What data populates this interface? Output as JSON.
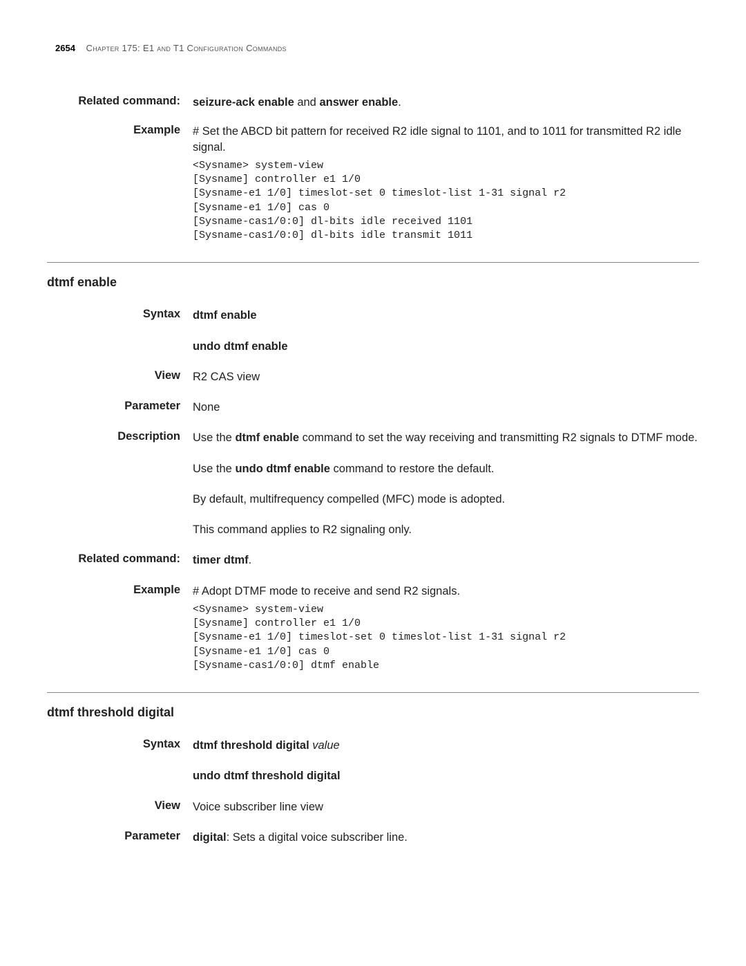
{
  "header": {
    "page_number": "2654",
    "chapter_text": "Chapter 175: E1 and T1 Configuration Commands"
  },
  "section1": {
    "related_command_label": "Related command:",
    "related_command_text_1": "seizure-ack enable",
    "related_command_mid": " and ",
    "related_command_text_2": "answer enable",
    "related_command_end": ".",
    "example_label": "Example",
    "example_intro": "# Set the ABCD bit pattern for received R2 idle signal to 1101, and to 1011 for transmitted R2 idle signal.",
    "code": "<Sysname> system-view\n[Sysname] controller e1 1/0\n[Sysname-e1 1/0] timeslot-set 0 timeslot-list 1-31 signal r2\n[Sysname-e1 1/0] cas 0\n[Sysname-cas1/0:0] dl-bits idle received 1101\n[Sysname-cas1/0:0] dl-bits idle transmit 1011"
  },
  "section2": {
    "title": "dtmf enable",
    "syntax_label": "Syntax",
    "syntax_line1": "dtmf enable",
    "syntax_line2": "undo dtmf enable",
    "view_label": "View",
    "view_text": "R2 CAS view",
    "parameter_label": "Parameter",
    "parameter_text": "None",
    "description_label": "Description",
    "desc_p1_pre": "Use the ",
    "desc_p1_bold": "dtmf enable",
    "desc_p1_post": " command to set the way receiving and transmitting R2 signals to DTMF mode.",
    "desc_p2_pre": "Use the ",
    "desc_p2_bold": "undo dtmf enable",
    "desc_p2_post": " command to restore the default.",
    "desc_p3": "By default, multifrequency compelled (MFC) mode is adopted.",
    "desc_p4": "This command applies to R2 signaling only.",
    "related_command_label": "Related command:",
    "related_command_bold": "timer dtmf",
    "related_command_end": ".",
    "example_label": "Example",
    "example_intro": "# Adopt DTMF mode to receive and send R2 signals.",
    "code": "<Sysname> system-view\n[Sysname] controller e1 1/0\n[Sysname-e1 1/0] timeslot-set 0 timeslot-list 1-31 signal r2\n[Sysname-e1 1/0] cas 0\n[Sysname-cas1/0:0] dtmf enable"
  },
  "section3": {
    "title": "dtmf threshold digital",
    "syntax_label": "Syntax",
    "syntax_line1_bold": "dtmf threshold digital ",
    "syntax_line1_italic": "value",
    "syntax_line2": "undo dtmf threshold digital",
    "view_label": "View",
    "view_text": "Voice subscriber line view",
    "parameter_label": "Parameter",
    "parameter_bold": "digital",
    "parameter_text": ": Sets a digital voice subscriber line."
  }
}
